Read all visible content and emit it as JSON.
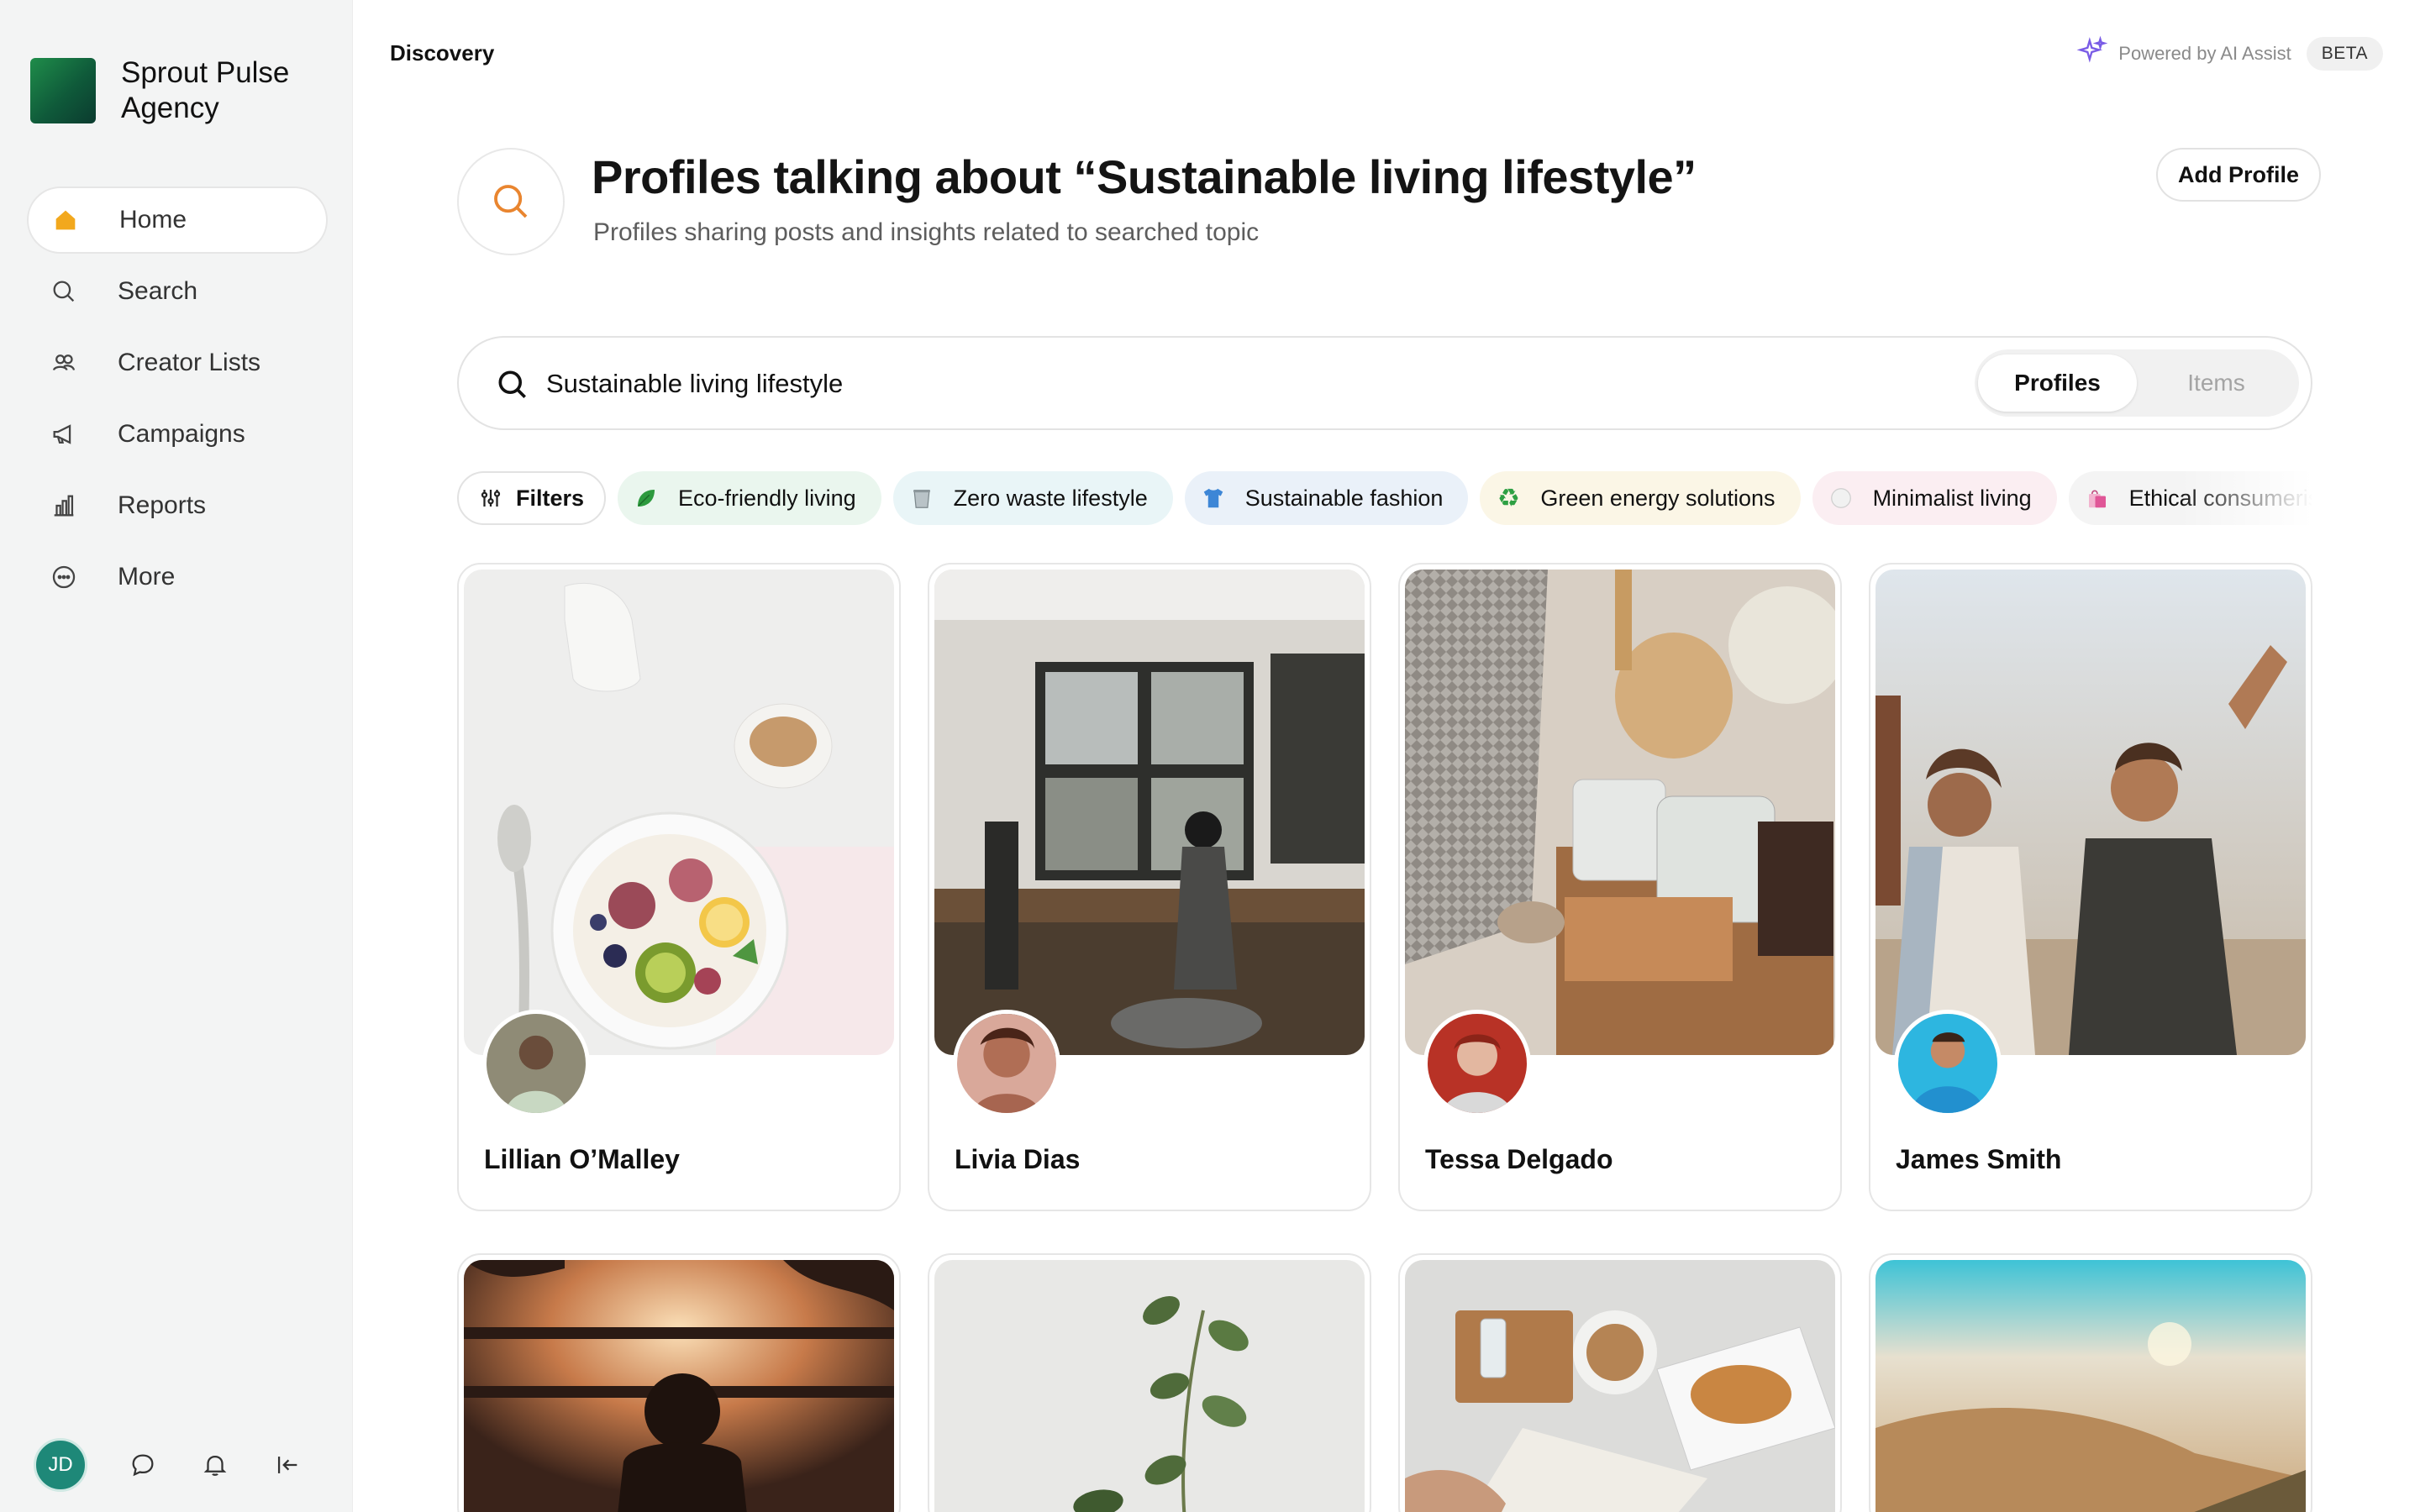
{
  "brand": {
    "name": "Sprout Pulse Agency"
  },
  "sidebar": {
    "items": [
      {
        "label": "Home",
        "icon": "home-icon",
        "active": true
      },
      {
        "label": "Search",
        "icon": "search-icon"
      },
      {
        "label": "Creator Lists",
        "icon": "users-icon"
      },
      {
        "label": "Campaigns",
        "icon": "megaphone-icon"
      },
      {
        "label": "Reports",
        "icon": "bar-chart-icon"
      },
      {
        "label": "More",
        "icon": "more-circle-icon"
      }
    ],
    "user_initials": "JD"
  },
  "topbar": {
    "breadcrumb": "Discovery",
    "ai_text": "Powered by AI Assist",
    "beta": "BETA"
  },
  "header": {
    "title": "Profiles talking about “Sustainable living lifestyle”",
    "subtitle": "Profiles sharing posts and insights related to searched topic",
    "add_profile": "Add Profile"
  },
  "search": {
    "value": "Sustainable living lifestyle",
    "tabs": [
      "Profiles",
      "Items"
    ],
    "active_tab": "Profiles"
  },
  "chips": {
    "filters_label": "Filters",
    "items": [
      {
        "label": "Eco-friendly living",
        "emoji": "🍃",
        "bg": "#eaf6ee"
      },
      {
        "label": "Zero waste lifestyle",
        "emoji": "🗑",
        "bg": "#e9f5f7"
      },
      {
        "label": "Sustainable fashion",
        "emoji": "👕",
        "bg": "#eaf1f9"
      },
      {
        "label": "Green energy solutions",
        "emoji": "♻",
        "bg": "#fbf6e6"
      },
      {
        "label": "Minimalist living",
        "emoji": "⚪",
        "bg": "#fbeef2"
      },
      {
        "label": "Ethical consumerism",
        "emoji": "🛍",
        "bg": "#f4f4f4"
      }
    ]
  },
  "profiles": [
    {
      "name": "Lillian O’Malley"
    },
    {
      "name": "Livia Dias"
    },
    {
      "name": "Tessa Delgado"
    },
    {
      "name": "James Smith"
    }
  ],
  "colors": {
    "accent": "#e9852f",
    "brand": "#1a7a44",
    "ai": "#7a5ce6"
  }
}
